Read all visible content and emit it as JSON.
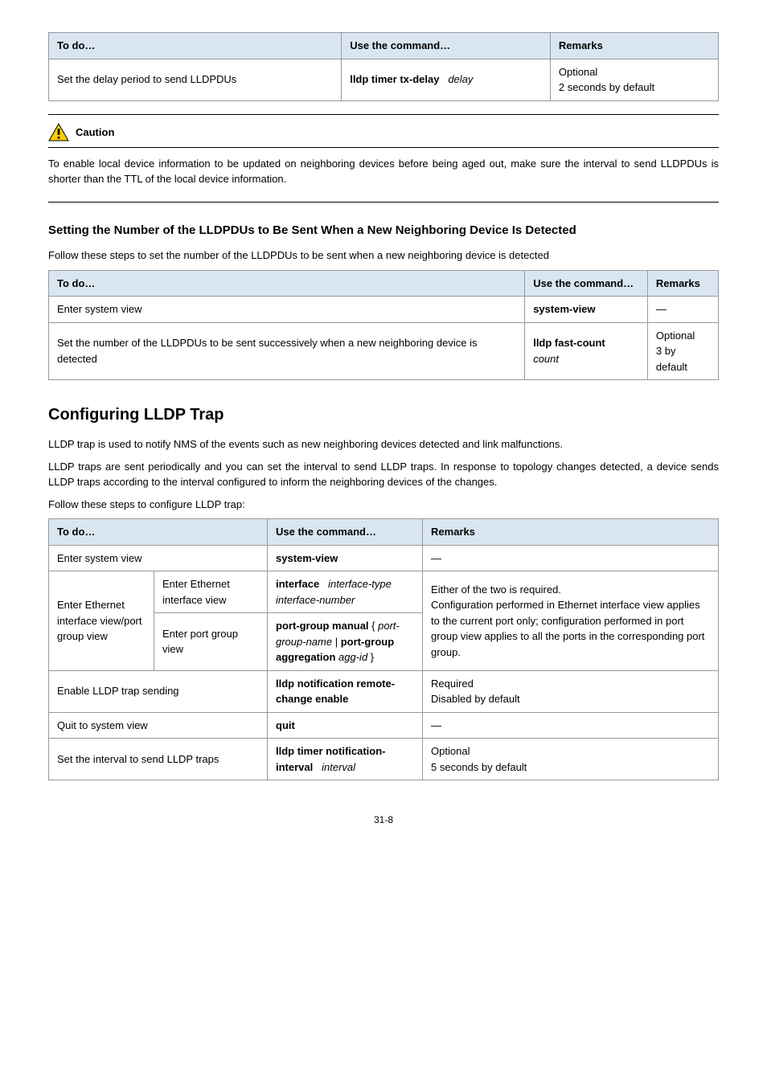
{
  "table1": {
    "headers": [
      "To do…",
      "Use the command…",
      "Remarks"
    ],
    "row": {
      "desc": "Set the delay period to send LLDPDUs",
      "cmd_bold": "lldp timer tx-delay",
      "cmd_arg": "delay",
      "remark1": "Optional",
      "remark2": "2 seconds by default"
    }
  },
  "caution": {
    "label": "Caution",
    "text": "To enable local device information to be updated on neighboring devices before being aged out, make sure the interval to send LLDPDUs is shorter than the TTL of the local device information."
  },
  "sub1_title": "Setting the Number of the LLDPDUs to Be Sent When a New Neighboring Device Is Detected",
  "sub1_intro": "Follow these steps to set the number of the LLDPDUs to be sent when a new neighboring device is detected",
  "table2": {
    "headers": [
      "To do…",
      "Use the command…",
      "Remarks"
    ],
    "rows": [
      {
        "desc": "Enter system view",
        "cmd_bold": "system-view",
        "cmd_arg": "",
        "remark": "—"
      },
      {
        "desc": "Set the number of the LLDPDUs to be sent successively when a new neighboring device is detected",
        "cmd_bold": "lldp fast-count",
        "cmd_arg": "count",
        "remark1": "Optional",
        "remark2": "3 by default"
      }
    ]
  },
  "section_title": "Configuring LLDP Trap",
  "section_p1": "LLDP trap is used to notify NMS of the events such as new neighboring devices detected and link malfunctions.",
  "section_p2": "LLDP traps are sent periodically and you can set the interval to send LLDP traps. In response to topology changes detected, a device sends LLDP traps according to the interval configured to inform the neighboring devices of the changes.",
  "section_p3": "Follow these steps to configure LLDP trap:",
  "table3": {
    "headers": [
      "To do…",
      "Use the command…",
      "Remarks"
    ],
    "r1_desc": "Enter system view",
    "r1_cmd": "system-view",
    "r1_rem": "—",
    "r2_leftcell": "Enter Ethernet interface view/port group view",
    "r2a_desc": "Enter Ethernet interface view",
    "r2a_cmd_bold": "interface",
    "r2a_cmd_arg": "interface-type interface-number",
    "r2b_desc": "Enter port group view",
    "r2b_cmd_bold1": "port-group manual",
    "r2b_cmd_arg1": "port-group-name",
    "r2b_cmd_bold2": "port-group aggregation",
    "r2b_cmd_arg2": "agg-id",
    "r2_rem_line1": "Either of the two is required.",
    "r2_rem_line2": "Configuration performed in Ethernet interface view applies to the current port only; configuration performed in port group view applies to all the ports in the corresponding port group.",
    "r3_desc": "Enable LLDP trap sending",
    "r3_cmd_bold": "lldp notification remote-change enable",
    "r3_rem1": "Required",
    "r3_rem2": "Disabled by default",
    "r4_desc": "Quit to system view",
    "r4_cmd": "quit",
    "r4_rem": "—",
    "r5_desc": "Set the interval to send LLDP traps",
    "r5_cmd_bold": "lldp timer notification-interval",
    "r5_cmd_arg": "interval",
    "r5_rem1": "Optional",
    "r5_rem2": "5 seconds by default"
  },
  "pagenum": "31-8"
}
